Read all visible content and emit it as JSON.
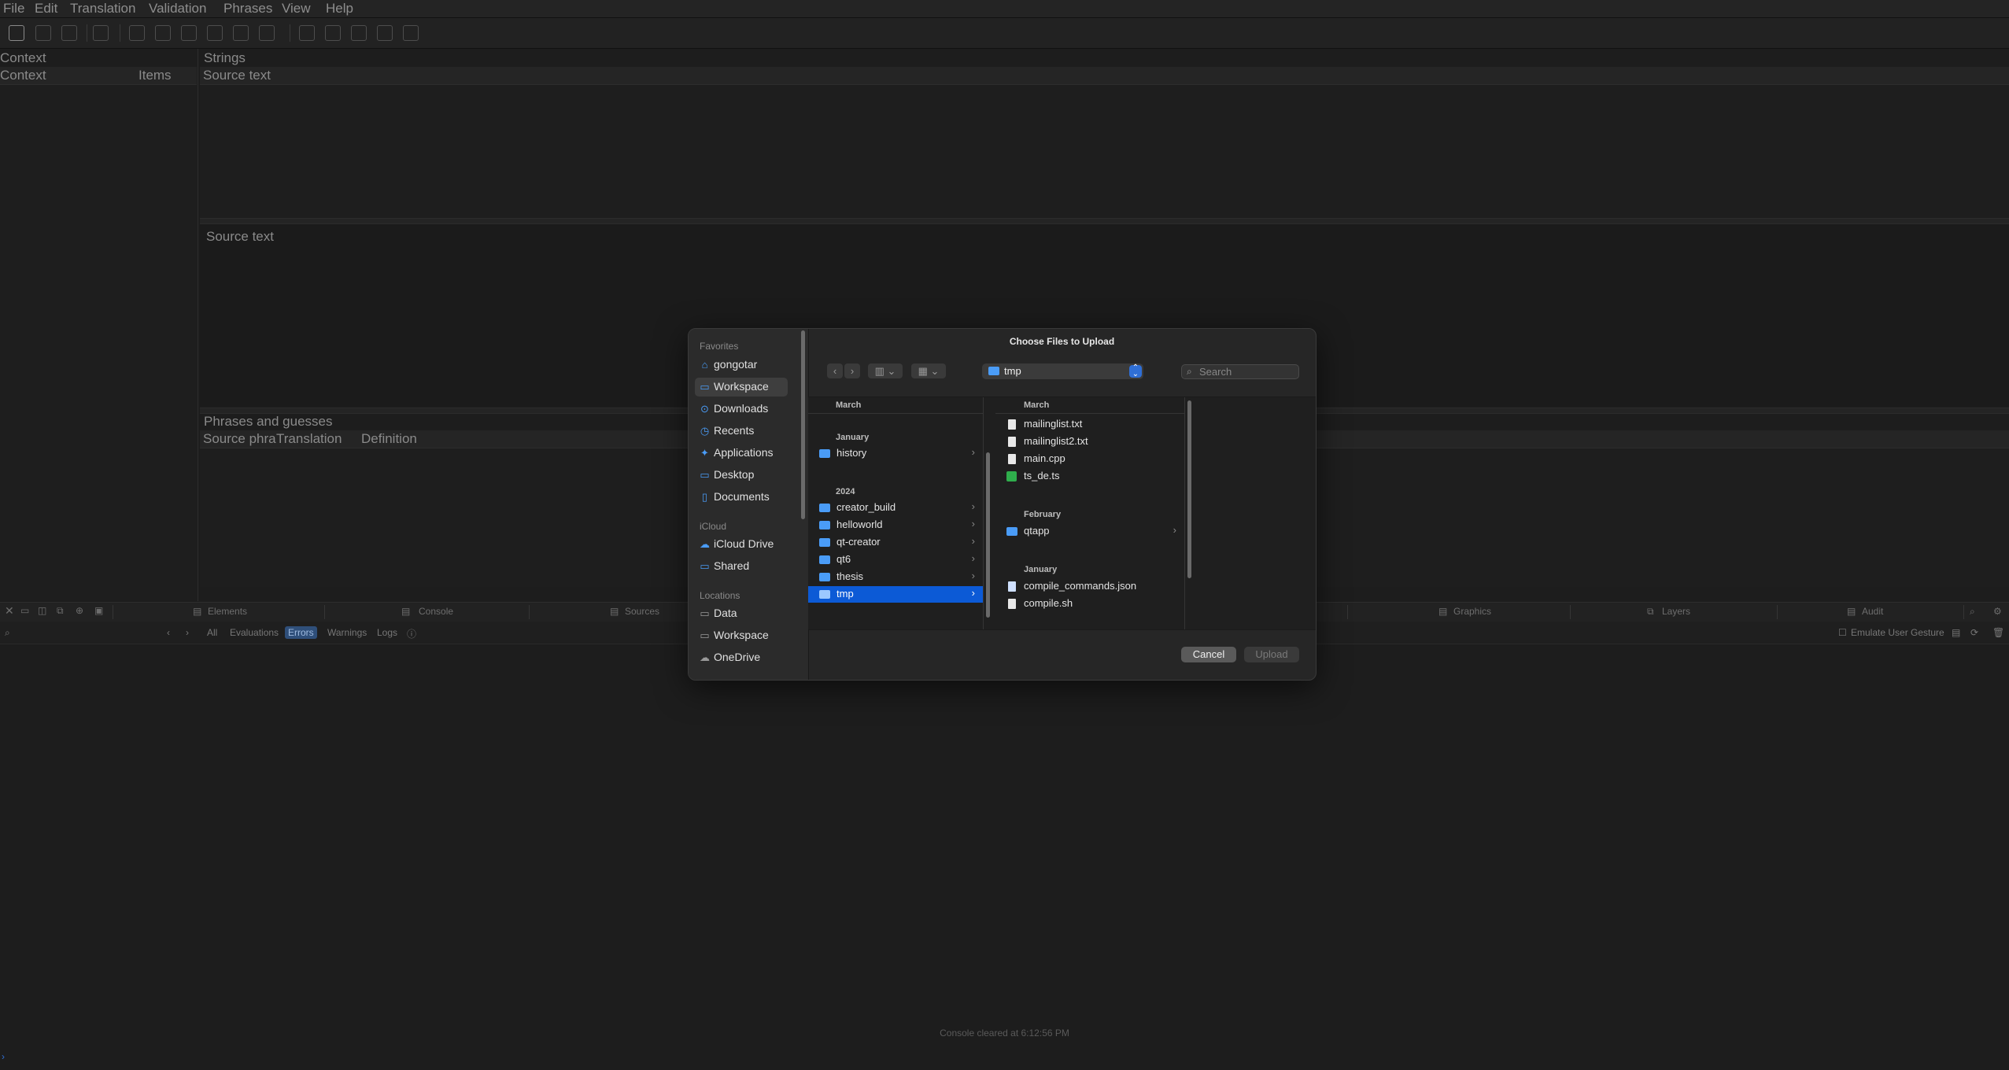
{
  "menu": [
    "File",
    "Edit",
    "Translation",
    "Validation",
    "Phrases",
    "View",
    "Help"
  ],
  "panels": {
    "context_title": "Context",
    "context_col1": "Context",
    "context_col2": "Items",
    "strings_title": "Strings",
    "strings_col": "Source text",
    "source_label": "Source text",
    "phrases_title": "Phrases and guesses",
    "phrases_col1": "Source phra",
    "phrases_col2": "Translation",
    "phrases_col3": "Definition"
  },
  "devtools": {
    "tabs": [
      "Elements",
      "Console",
      "Sources",
      "Graphics",
      "Layers",
      "Audit"
    ],
    "filters": [
      "All",
      "Evaluations",
      "Errors",
      "Warnings",
      "Logs"
    ],
    "selected_filter": "Errors",
    "emulate_label": "Emulate User Gesture",
    "status": "Console cleared at 6:12:56 PM"
  },
  "dialog": {
    "title": "Choose Files to Upload",
    "current_folder": "tmp",
    "search_placeholder": "Search",
    "cancel": "Cancel",
    "upload": "Upload",
    "sidebar": {
      "favorites_label": "Favorites",
      "favorites": [
        "gongotar",
        "Workspace",
        "Downloads",
        "Recents",
        "Applications",
        "Desktop",
        "Documents"
      ],
      "selected": "Workspace",
      "icloud_label": "iCloud",
      "icloud": [
        "iCloud Drive",
        "Shared"
      ],
      "locations_label": "Locations",
      "locations": [
        "Data",
        "Workspace",
        "OneDrive"
      ]
    },
    "column1": {
      "top_header": "March",
      "january_header": "January",
      "january_items": [
        "history"
      ],
      "year_header": "2024",
      "year_items": [
        "creator_build",
        "helloworld",
        "qt-creator",
        "qt6",
        "thesis",
        "tmp"
      ],
      "selected": "tmp"
    },
    "column2": {
      "march_header": "March",
      "march_items": [
        "mailinglist.txt",
        "mailinglist2.txt",
        "main.cpp",
        "ts_de.ts"
      ],
      "february_header": "February",
      "february_items": [
        "qtapp"
      ],
      "january_header": "January",
      "january_items": [
        "compile_commands.json",
        "compile.sh"
      ]
    }
  }
}
